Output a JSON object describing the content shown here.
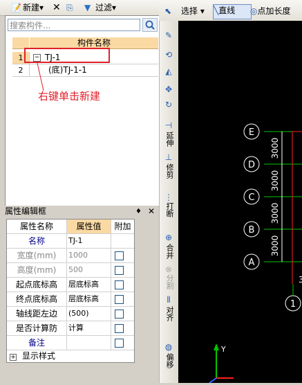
{
  "toolbar": {
    "new_label": "新建",
    "filter_label": "过滤"
  },
  "search": {
    "placeholder": "搜索构件..."
  },
  "component_grid": {
    "header": "构件名称",
    "rows": [
      {
        "num": "1",
        "label": "TJ-1"
      },
      {
        "num": "2",
        "label": "(底)TJ-1-1"
      }
    ]
  },
  "annotation": "右键单击新建",
  "props_panel": {
    "title": "属性编辑框",
    "headers": [
      "属性名称",
      "属性值",
      "附加"
    ],
    "rows": [
      {
        "name": "名称",
        "value": "TJ-1"
      },
      {
        "name": "宽度(mm)",
        "value": "1000"
      },
      {
        "name": "高度(mm)",
        "value": "500"
      },
      {
        "name": "起点底标高",
        "value": "层底标高"
      },
      {
        "name": "终点底标高",
        "value": "层底标高"
      },
      {
        "name": "轴线距左边",
        "value": "(500)"
      },
      {
        "name": "是否计算防",
        "value": "计算"
      },
      {
        "name": "备注",
        "value": ""
      },
      {
        "name": "显示样式",
        "value": ""
      }
    ]
  },
  "right_toolbar": {
    "select_label": "选择",
    "line_label": "直线",
    "point_length_label": "点加长度"
  },
  "vertical_tools": [
    "延伸",
    "修剪",
    "打断",
    "合并",
    "分割",
    "对齐",
    "偏移"
  ],
  "canvas": {
    "axis_labels": [
      "E",
      "D",
      "C",
      "B",
      "A"
    ],
    "dimensions": [
      "3000",
      "3000",
      "3000",
      "3000"
    ],
    "bottom_axis": "1",
    "y_label": "Y",
    "partial_dim": "3",
    "colors": {
      "axis_circle": "#ffffff",
      "grid_line": "#00c800",
      "dim_text": "#ffffff",
      "red_line": "#ff2020"
    }
  }
}
